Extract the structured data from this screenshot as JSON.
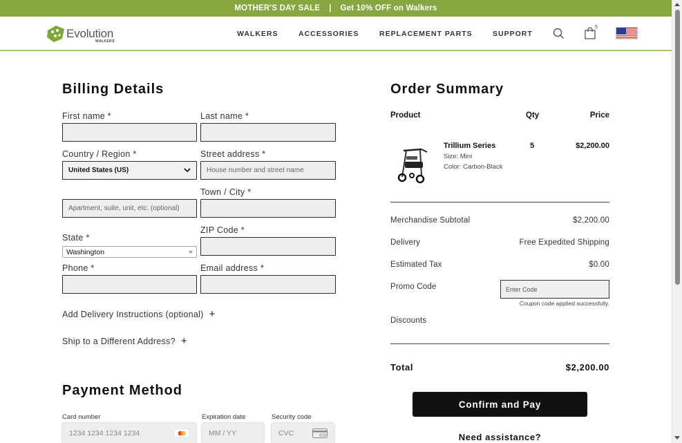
{
  "promo": {
    "left": "MOTHER'S DAY SALE",
    "sep": "|",
    "right": "Get 10% OFF on Walkers"
  },
  "header": {
    "logo_text": "Evolution",
    "logo_sub": "WALKERS",
    "nav": [
      "WALKERS",
      "ACCESSORIES",
      "REPLACEMENT PARTS",
      "SUPPORT"
    ],
    "cart_count": "5",
    "icons": {
      "search": "search-icon",
      "cart": "shopping-bag-icon",
      "flag": "us-flag-icon"
    }
  },
  "billing": {
    "title": "Billing Details",
    "first_name": {
      "label": "First name *",
      "value": ""
    },
    "last_name": {
      "label": "Last name *",
      "value": ""
    },
    "country": {
      "label": "Country / Region *",
      "value": "United States (US)"
    },
    "street": {
      "label": "Street address *",
      "placeholder": "House number and street name"
    },
    "apartment": {
      "placeholder": "Apartment, suite, unit, etc. (optional)"
    },
    "town": {
      "label": "Town / City *",
      "value": ""
    },
    "state": {
      "label": "State *",
      "value": "Washington"
    },
    "zip": {
      "label": "ZIP Code *",
      "value": ""
    },
    "phone": {
      "label": "Phone *",
      "value": ""
    },
    "email": {
      "label": "Email address *",
      "value": ""
    },
    "delivery_instructions": "Add Delivery Instructions (optional)",
    "ship_different": "Ship to a Different Address?",
    "plus": "+"
  },
  "payment": {
    "title": "Payment Method",
    "card_number": {
      "label": "Card number",
      "placeholder": "1234 1234 1234 1234"
    },
    "expiration": {
      "label": "Expiration date",
      "placeholder": "MM / YY"
    },
    "security": {
      "label": "Security code",
      "placeholder": "CVC"
    }
  },
  "order": {
    "title": "Order Summary",
    "columns": {
      "product": "Product",
      "qty": "Qty",
      "price": "Price"
    },
    "item": {
      "name": "Trillium Series",
      "size": "Size: Mini",
      "color": "Color: Carbon-Black",
      "qty": "5",
      "price": "$2,200.00"
    },
    "subtotal": {
      "label": "Merchandise Subtotal",
      "value": "$2,200.00"
    },
    "delivery": {
      "label": "Delivery",
      "value": "Free Expedited Shipping"
    },
    "tax": {
      "label": "Estimated Tax",
      "value": "$0.00"
    },
    "promo": {
      "label": "Promo Code",
      "placeholder": "Enter Code",
      "message": "Coupon code applied successfully."
    },
    "discounts": {
      "label": "Discounts"
    },
    "total": {
      "label": "Total",
      "value": "$2,200.00"
    },
    "confirm": "Confirm and Pay",
    "assist": "Need assistance?"
  },
  "colors": {
    "accent": "#86a740",
    "button": "#111111"
  }
}
